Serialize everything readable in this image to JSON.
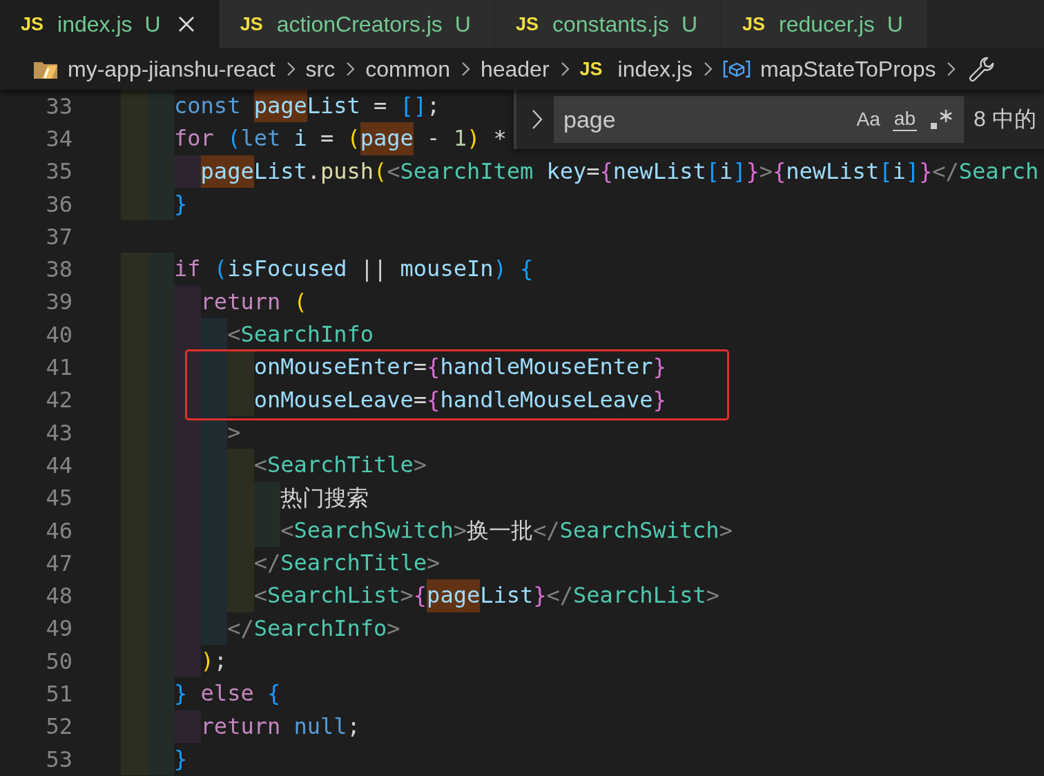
{
  "tabs": [
    {
      "file_icon": "JS",
      "label": "index.js",
      "status": "U",
      "selected": true,
      "closable": true
    },
    {
      "file_icon": "JS",
      "label": "actionCreators.js",
      "status": "U",
      "selected": false,
      "closable": false
    },
    {
      "file_icon": "JS",
      "label": "constants.js",
      "status": "U",
      "selected": false,
      "closable": false
    },
    {
      "file_icon": "JS",
      "label": "reducer.js",
      "status": "U",
      "selected": false,
      "closable": false
    }
  ],
  "breadcrumb": [
    {
      "kind": "root",
      "label": "my-app-jianshu-react"
    },
    {
      "kind": "folder",
      "label": "src"
    },
    {
      "kind": "folder",
      "label": "common"
    },
    {
      "kind": "folder",
      "label": "header"
    },
    {
      "kind": "file",
      "file_icon": "JS",
      "label": "index.js"
    },
    {
      "kind": "symbol",
      "label": "mapStateToProps"
    }
  ],
  "find_widget": {
    "value": "page",
    "options": [
      "Aa",
      "ab"
    ],
    "result": "8 中的"
  },
  "lines": [
    {
      "number": "33",
      "boxed": false,
      "tokens": [
        {
          "text": "    const ",
          "kind": "kw",
          "match": false
        },
        {
          "text": "page",
          "kind": "var",
          "match": true
        },
        {
          "text": "List",
          "kind": "var",
          "match": false
        },
        {
          "text": " = ",
          "kind": "punc",
          "match": false
        },
        {
          "text": "[]",
          "kind": "b3",
          "match": false
        },
        {
          "text": ";",
          "kind": "punc",
          "match": false
        }
      ]
    },
    {
      "number": "34",
      "boxed": false,
      "tokens": [
        {
          "text": "    for ",
          "kind": "ctrl",
          "match": false
        },
        {
          "text": "(",
          "kind": "b3",
          "match": false
        },
        {
          "text": "let ",
          "kind": "kw",
          "match": false
        },
        {
          "text": "i",
          "kind": "var",
          "match": false
        },
        {
          "text": " = ",
          "kind": "punc",
          "match": false
        },
        {
          "text": "(",
          "kind": "b1",
          "match": false
        },
        {
          "text": "page",
          "kind": "var",
          "match": true
        },
        {
          "text": " - ",
          "kind": "punc",
          "match": false
        },
        {
          "text": "1",
          "kind": "num",
          "match": false
        },
        {
          "text": ")",
          "kind": "b1",
          "match": false
        },
        {
          "text": " *",
          "kind": "punc",
          "match": false
        }
      ]
    },
    {
      "number": "35",
      "boxed": false,
      "tokens": [
        {
          "text": "      page",
          "kind": "var",
          "match": true
        },
        {
          "text": "List",
          "kind": "var",
          "match": false
        },
        {
          "text": ".",
          "kind": "punc",
          "match": false
        },
        {
          "text": "push",
          "kind": "fn",
          "match": false
        },
        {
          "text": "(",
          "kind": "b1",
          "match": false
        },
        {
          "text": "<",
          "kind": "angle",
          "match": false
        },
        {
          "text": "SearchItem ",
          "kind": "tag",
          "match": false
        },
        {
          "text": "key",
          "kind": "attr",
          "match": false
        },
        {
          "text": "=",
          "kind": "punc",
          "match": false
        },
        {
          "text": "{",
          "kind": "b2",
          "match": false
        },
        {
          "text": "newList",
          "kind": "var",
          "match": false
        },
        {
          "text": "[",
          "kind": "b3",
          "match": false
        },
        {
          "text": "i",
          "kind": "var",
          "match": false
        },
        {
          "text": "]",
          "kind": "b3",
          "match": false
        },
        {
          "text": "}",
          "kind": "b2",
          "match": false
        },
        {
          "text": ">",
          "kind": "angle",
          "match": false
        },
        {
          "text": "{",
          "kind": "b2",
          "match": false
        },
        {
          "text": "newList",
          "kind": "var",
          "match": false
        },
        {
          "text": "[",
          "kind": "b3",
          "match": false
        },
        {
          "text": "i",
          "kind": "var",
          "match": false
        },
        {
          "text": "]",
          "kind": "b3",
          "match": false
        },
        {
          "text": "}",
          "kind": "b2",
          "match": false
        },
        {
          "text": "</",
          "kind": "angle",
          "match": false
        },
        {
          "text": "Search",
          "kind": "tag",
          "match": false
        }
      ]
    },
    {
      "number": "36",
      "boxed": false,
      "tokens": [
        {
          "text": "    }",
          "kind": "b3",
          "match": false
        }
      ]
    },
    {
      "number": "37",
      "boxed": false
    },
    {
      "number": "38",
      "boxed": false,
      "tokens": [
        {
          "text": "    if ",
          "kind": "ctrl",
          "match": false
        },
        {
          "text": "(",
          "kind": "b3",
          "match": false
        },
        {
          "text": "isFocused",
          "kind": "var",
          "match": false
        },
        {
          "text": " || ",
          "kind": "punc",
          "match": false
        },
        {
          "text": "mouseIn",
          "kind": "var",
          "match": false
        },
        {
          "text": ")",
          "kind": "b3",
          "match": false
        },
        {
          "text": " {",
          "kind": "b3",
          "match": false
        }
      ]
    },
    {
      "number": "39",
      "boxed": false,
      "tokens": [
        {
          "text": "      return ",
          "kind": "ctrl",
          "match": false
        },
        {
          "text": "(",
          "kind": "b1",
          "match": false
        }
      ]
    },
    {
      "number": "40",
      "boxed": false,
      "tokens": [
        {
          "text": "        <",
          "kind": "angle",
          "match": false
        },
        {
          "text": "SearchInfo",
          "kind": "tag",
          "match": false
        }
      ]
    },
    {
      "number": "41",
      "boxed": true,
      "tokens": [
        {
          "text": "          onMouseEnter",
          "kind": "attr",
          "match": false
        },
        {
          "text": "=",
          "kind": "punc",
          "match": false
        },
        {
          "text": "{",
          "kind": "b2",
          "match": false
        },
        {
          "text": "handleMouseEnter",
          "kind": "var",
          "match": false
        },
        {
          "text": "}",
          "kind": "b2",
          "match": false
        }
      ]
    },
    {
      "number": "42",
      "boxed": true,
      "tokens": [
        {
          "text": "          onMouseLeave",
          "kind": "attr",
          "match": false
        },
        {
          "text": "=",
          "kind": "punc",
          "match": false
        },
        {
          "text": "{",
          "kind": "b2",
          "match": false
        },
        {
          "text": "handleMouseLeave",
          "kind": "var",
          "match": false
        },
        {
          "text": "}",
          "kind": "b2",
          "match": false
        }
      ]
    },
    {
      "number": "43",
      "boxed": false,
      "tokens": [
        {
          "text": "        >",
          "kind": "angle",
          "match": false
        }
      ]
    },
    {
      "number": "44",
      "boxed": false,
      "tokens": [
        {
          "text": "          <",
          "kind": "angle",
          "match": false
        },
        {
          "text": "SearchTitle",
          "kind": "tag",
          "match": false
        },
        {
          "text": ">",
          "kind": "angle",
          "match": false
        }
      ]
    },
    {
      "number": "45",
      "boxed": false,
      "tokens": [
        {
          "text": "            热门搜索",
          "kind": "text",
          "match": false
        }
      ]
    },
    {
      "number": "46",
      "boxed": false,
      "tokens": [
        {
          "text": "            <",
          "kind": "angle",
          "match": false
        },
        {
          "text": "SearchSwitch",
          "kind": "tag",
          "match": false
        },
        {
          "text": ">",
          "kind": "angle",
          "match": false
        },
        {
          "text": "换一批",
          "kind": "text",
          "match": false
        },
        {
          "text": "</",
          "kind": "angle",
          "match": false
        },
        {
          "text": "SearchSwitch",
          "kind": "tag",
          "match": false
        },
        {
          "text": ">",
          "kind": "angle",
          "match": false
        }
      ]
    },
    {
      "number": "47",
      "boxed": false,
      "tokens": [
        {
          "text": "          </",
          "kind": "angle",
          "match": false
        },
        {
          "text": "SearchTitle",
          "kind": "tag",
          "match": false
        },
        {
          "text": ">",
          "kind": "angle",
          "match": false
        }
      ]
    },
    {
      "number": "48",
      "boxed": false,
      "tokens": [
        {
          "text": "          <",
          "kind": "angle",
          "match": false
        },
        {
          "text": "SearchList",
          "kind": "tag",
          "match": false
        },
        {
          "text": ">",
          "kind": "angle",
          "match": false
        },
        {
          "text": "{",
          "kind": "b2",
          "match": false
        },
        {
          "text": "page",
          "kind": "var",
          "match": true
        },
        {
          "text": "List",
          "kind": "var",
          "match": false
        },
        {
          "text": "}",
          "kind": "b2",
          "match": false
        },
        {
          "text": "</",
          "kind": "angle",
          "match": false
        },
        {
          "text": "SearchList",
          "kind": "tag",
          "match": false
        },
        {
          "text": ">",
          "kind": "angle",
          "match": false
        }
      ]
    },
    {
      "number": "49",
      "boxed": false,
      "tokens": [
        {
          "text": "        </",
          "kind": "angle",
          "match": false
        },
        {
          "text": "SearchInfo",
          "kind": "tag",
          "match": false
        },
        {
          "text": ">",
          "kind": "angle",
          "match": false
        }
      ]
    },
    {
      "number": "50",
      "boxed": false,
      "tokens": [
        {
          "text": "      )",
          "kind": "b1",
          "match": false
        },
        {
          "text": ";",
          "kind": "punc",
          "match": false
        }
      ]
    },
    {
      "number": "51",
      "boxed": false,
      "tokens": [
        {
          "text": "    }",
          "kind": "b3",
          "match": false
        },
        {
          "text": " else ",
          "kind": "ctrl",
          "match": false
        },
        {
          "text": "{",
          "kind": "b3",
          "match": false
        }
      ]
    },
    {
      "number": "52",
      "boxed": false,
      "tokens": [
        {
          "text": "      return ",
          "kind": "ctrl",
          "match": false
        },
        {
          "text": "null",
          "kind": "kw",
          "match": false
        },
        {
          "text": ";",
          "kind": "punc",
          "match": false
        }
      ]
    },
    {
      "number": "53",
      "boxed": false,
      "tokens": [
        {
          "text": "    }",
          "kind": "b3",
          "match": false
        }
      ]
    }
  ]
}
